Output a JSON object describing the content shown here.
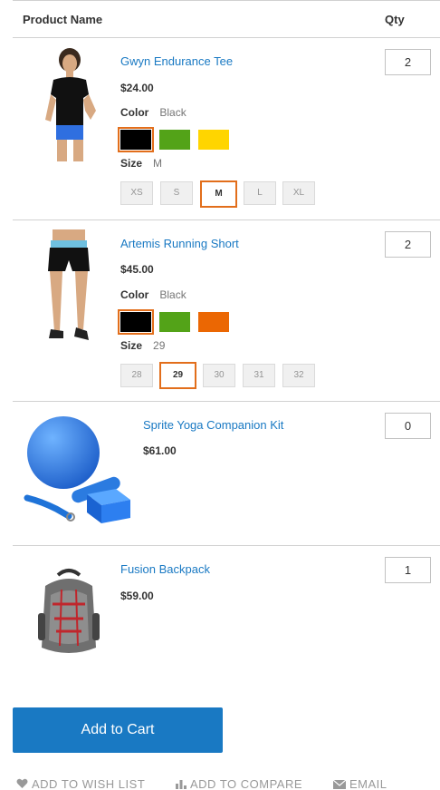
{
  "table": {
    "col_product": "Product Name",
    "col_qty": "Qty"
  },
  "items": [
    {
      "name": "Gwyn Endurance Tee",
      "price": "$24.00",
      "qty": "2",
      "color_label": "Color",
      "color_value": "Black",
      "swatches": [
        "#000000",
        "#53a318",
        "#ffd500"
      ],
      "size_label": "Size",
      "size_value": "M",
      "sizes": [
        "XS",
        "S",
        "M",
        "L",
        "XL"
      ]
    },
    {
      "name": "Artemis Running Short",
      "price": "$45.00",
      "qty": "2",
      "color_label": "Color",
      "color_value": "Black",
      "swatches": [
        "#000000",
        "#53a318",
        "#eb6703"
      ],
      "size_label": "Size",
      "size_value": "29",
      "sizes": [
        "28",
        "29",
        "30",
        "31",
        "32"
      ]
    },
    {
      "name": "Sprite Yoga Companion Kit",
      "price": "$61.00",
      "qty": "0"
    },
    {
      "name": "Fusion Backpack",
      "price": "$59.00",
      "qty": "1"
    }
  ],
  "add_to_cart": "Add to Cart",
  "actions": {
    "wishlist": "ADD TO WISH LIST",
    "compare": "ADD TO COMPARE",
    "email": "EMAIL"
  },
  "colors": {
    "link": "#1979c3",
    "button": "#1979c3",
    "selected_outline": "#e26e1b",
    "muted": "#999999"
  }
}
